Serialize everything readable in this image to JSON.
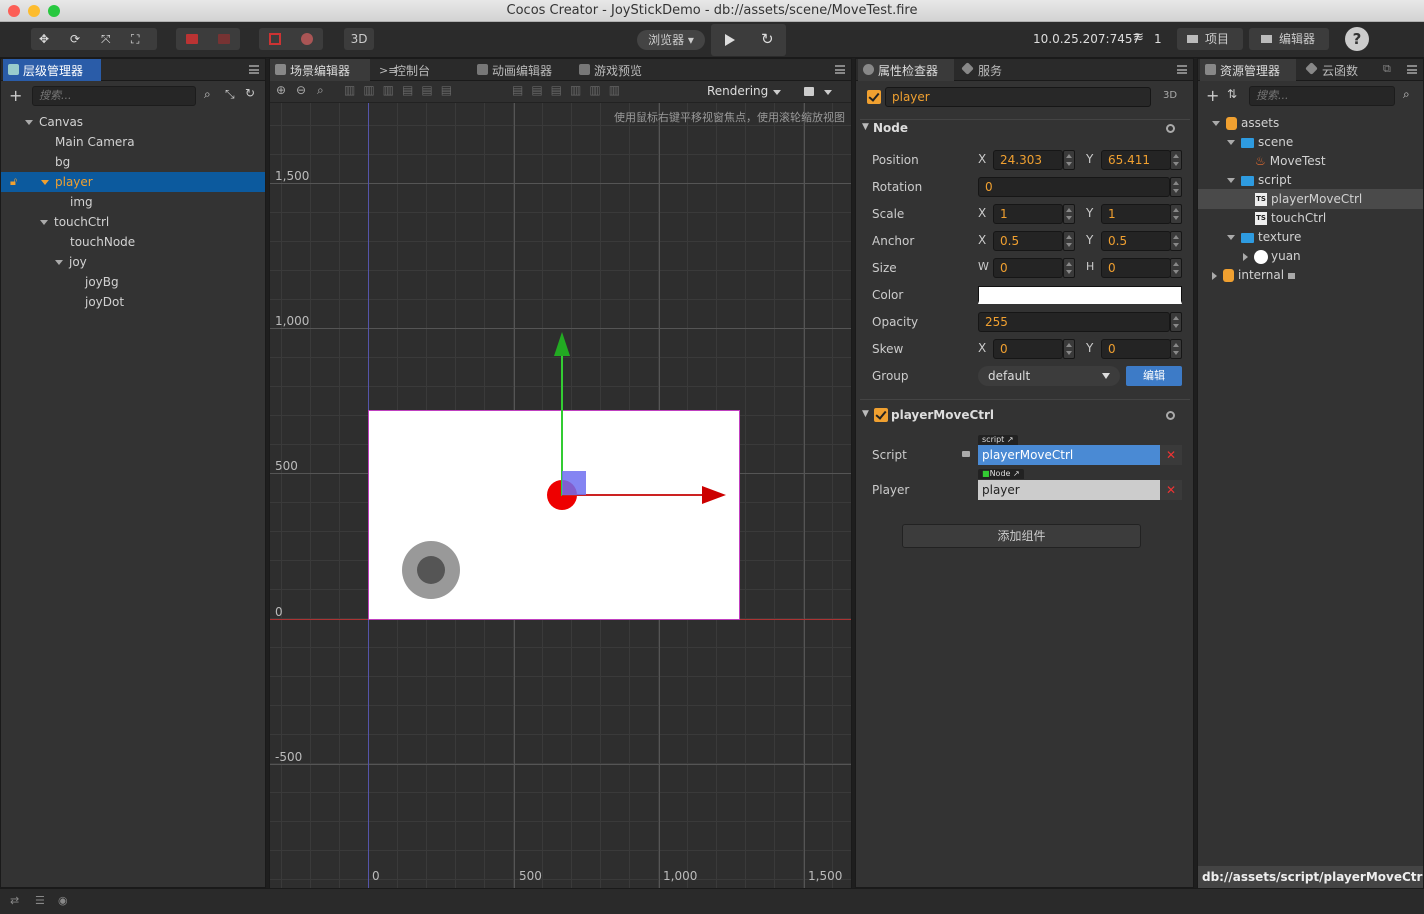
{
  "window": {
    "title": "Cocos Creator - JoyStickDemo - db://assets/scene/MoveTest.fire"
  },
  "toolbar": {
    "mode_3d": "3D",
    "browser_label": "浏览器 ▾",
    "ip_address": "10.0.25.207:7457",
    "connections": "1",
    "project_label": "项目",
    "editor_label": "编辑器",
    "help_label": "?"
  },
  "hierarchy": {
    "tab_label": "层级管理器",
    "search_placeholder": "搜索...",
    "nodes": [
      {
        "label": "Canvas"
      },
      {
        "label": "Main Camera"
      },
      {
        "label": "bg"
      },
      {
        "label": "player"
      },
      {
        "label": "img"
      },
      {
        "label": "touchCtrl"
      },
      {
        "label": "touchNode"
      },
      {
        "label": "joy"
      },
      {
        "label": "joyBg"
      },
      {
        "label": "joyDot"
      }
    ]
  },
  "scene": {
    "tabs": [
      "场景编辑器",
      "控制台",
      "动画编辑器",
      "游戏预览"
    ],
    "rendering_label": "Rendering",
    "hint": "使用鼠标右键平移视窗焦点，使用滚轮缩放视图",
    "y_ticks": [
      "1,500",
      "1,000",
      "500",
      "0",
      "-500"
    ],
    "x_ticks": [
      "0",
      "500",
      "1,000",
      "1,500"
    ]
  },
  "inspector": {
    "tabs": [
      "属性检查器",
      "服务"
    ],
    "node_name": "player",
    "mode_3d": "3D",
    "node_section": "Node",
    "position": {
      "label": "Position",
      "x_label": "X",
      "x": "24.303",
      "y_label": "Y",
      "y": "65.411"
    },
    "rotation": {
      "label": "Rotation",
      "value": "0"
    },
    "scale": {
      "label": "Scale",
      "x_label": "X",
      "x": "1",
      "y_label": "Y",
      "y": "1"
    },
    "anchor": {
      "label": "Anchor",
      "x_label": "X",
      "x": "0.5",
      "y_label": "Y",
      "y": "0.5"
    },
    "size": {
      "label": "Size",
      "w_label": "W",
      "w": "0",
      "h_label": "H",
      "h": "0"
    },
    "color": {
      "label": "Color",
      "value": "#ffffff"
    },
    "opacity": {
      "label": "Opacity",
      "value": "255"
    },
    "skew": {
      "label": "Skew",
      "x_label": "X",
      "x": "0",
      "y_label": "Y",
      "y": "0"
    },
    "group": {
      "label": "Group",
      "value": "default",
      "edit_button": "编辑"
    },
    "component": {
      "name": "playerMoveCtrl",
      "script_label": "Script",
      "script_tag": "script",
      "script_value": "playerMoveCtrl",
      "player_label": "Player",
      "player_tag": "Node",
      "player_value": "player"
    },
    "add_component": "添加组件"
  },
  "assets": {
    "tabs": [
      "资源管理器",
      "云函数"
    ],
    "search_placeholder": "搜索...",
    "items": [
      {
        "label": "assets"
      },
      {
        "label": "scene"
      },
      {
        "label": "MoveTest"
      },
      {
        "label": "script"
      },
      {
        "label": "playerMoveCtrl"
      },
      {
        "label": "touchCtrl"
      },
      {
        "label": "texture"
      },
      {
        "label": "yuan"
      },
      {
        "label": "internal"
      }
    ],
    "path": "db://assets/script/playerMoveCtrl..."
  },
  "colors": {
    "accent": "#f0a030",
    "selection": "#0c5a9e",
    "button_blue": "#3d7bc7"
  }
}
